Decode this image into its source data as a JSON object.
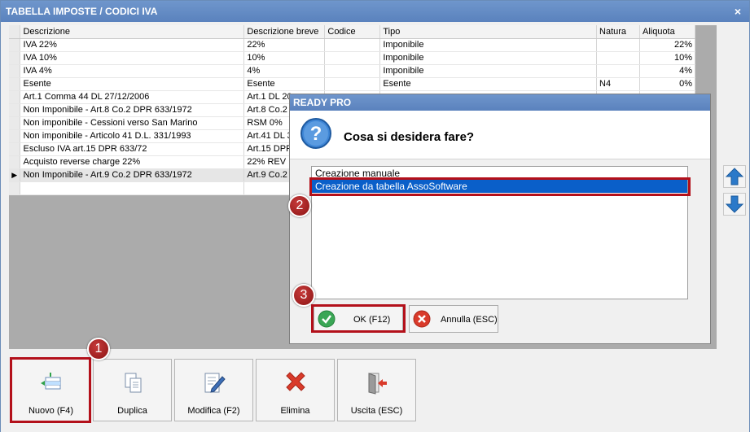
{
  "window": {
    "title": "TABELLA IMPOSTE / CODICI IVA",
    "close_glyph": "×"
  },
  "grid": {
    "columns": [
      "Descrizione",
      "Descrizione breve",
      "Codice",
      "Tipo",
      "Natura",
      "Aliquota"
    ],
    "rows": [
      {
        "desc": "IVA 22%",
        "breve": "22%",
        "codice": "",
        "tipo": "Imponibile",
        "natura": "",
        "aliquota": "22%"
      },
      {
        "desc": "IVA 10%",
        "breve": "10%",
        "codice": "",
        "tipo": "Imponibile",
        "natura": "",
        "aliquota": "10%"
      },
      {
        "desc": "IVA 4%",
        "breve": "4%",
        "codice": "",
        "tipo": "Imponibile",
        "natura": "",
        "aliquota": "4%"
      },
      {
        "desc": "Esente",
        "breve": "Esente",
        "codice": "",
        "tipo": "Esente",
        "natura": "N4",
        "aliquota": "0%"
      },
      {
        "desc": "Art.1 Comma 44 DL 27/12/2006",
        "breve": "Art.1 DL 20",
        "codice": "",
        "tipo": "",
        "natura": "",
        "aliquota": ""
      },
      {
        "desc": "Non Imponibile - Art.8 Co.2 DPR 633/1972",
        "breve": "Art.8 Co.2",
        "codice": "",
        "tipo": "",
        "natura": "",
        "aliquota": ""
      },
      {
        "desc": "Non imponibile - Cessioni verso San Marino",
        "breve": "RSM 0%",
        "codice": "",
        "tipo": "",
        "natura": "",
        "aliquota": ""
      },
      {
        "desc": "Non imponibile - Articolo 41 D.L. 331/1993",
        "breve": "Art.41 DL 3",
        "codice": "",
        "tipo": "",
        "natura": "",
        "aliquota": ""
      },
      {
        "desc": "Escluso IVA art.15 DPR 633/72",
        "breve": "Art.15 DPR",
        "codice": "",
        "tipo": "",
        "natura": "",
        "aliquota": ""
      },
      {
        "desc": "Acquisto reverse charge 22%",
        "breve": "22% REV",
        "codice": "",
        "tipo": "",
        "natura": "",
        "aliquota": ""
      },
      {
        "desc": "Non Imponibile - Art.9 Co.2 DPR 633/1972",
        "breve": "Art.9 Co.2",
        "codice": "",
        "tipo": "",
        "natura": "",
        "aliquota": ""
      },
      {
        "desc": "",
        "breve": "",
        "codice": "",
        "tipo": "",
        "natura": "",
        "aliquota": ""
      }
    ],
    "current_row_marker": "▶"
  },
  "toolbar": {
    "nuovo": "Nuovo (F4)",
    "duplica": "Duplica",
    "modifica": "Modifica (F2)",
    "elimina": "Elimina",
    "uscita": "Uscita (ESC)"
  },
  "dialog": {
    "title": "READY PRO",
    "question": "Cosa si desidera fare?",
    "options": [
      "Creazione manuale",
      "Creazione da tabella AssoSoftware"
    ],
    "selected_option": "Creazione da tabella AssoSoftware",
    "ok_label": "OK (F12)",
    "cancel_label": "Annulla (ESC)"
  },
  "annotations": {
    "badge1": "1",
    "badge2": "2",
    "badge3": "3"
  },
  "colors": {
    "titlebar": "#5a82bd",
    "highlight": "#b3101a",
    "selection": "#0a5fc9",
    "arrow_blue": "#2b79c9"
  }
}
